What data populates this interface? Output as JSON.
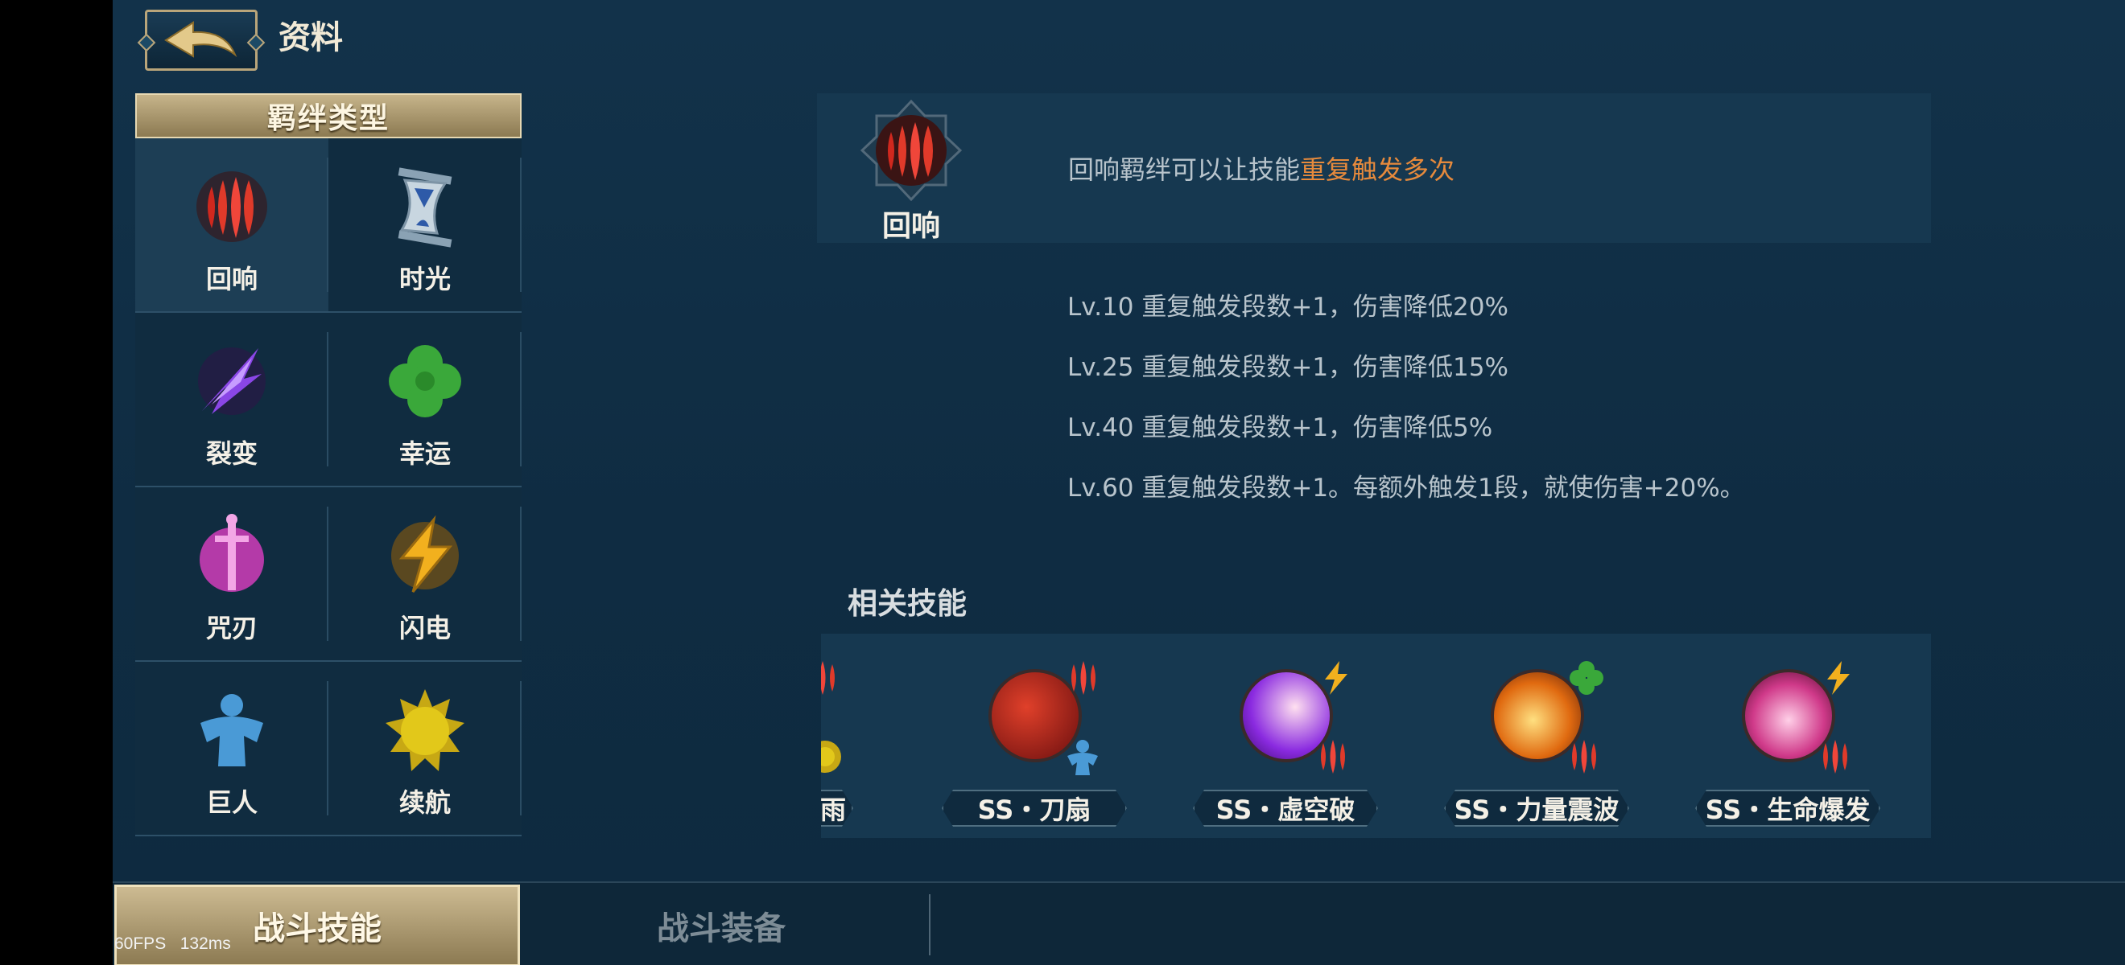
{
  "header": {
    "title": "资料"
  },
  "categories": {
    "title": "羁绊类型",
    "items": [
      {
        "label": "回响",
        "icon": "echo-icon"
      },
      {
        "label": "时光",
        "icon": "hourglass-icon"
      },
      {
        "label": "裂变",
        "icon": "fission-icon"
      },
      {
        "label": "幸运",
        "icon": "clover-icon"
      },
      {
        "label": "咒刃",
        "icon": "cursed-blade-icon"
      },
      {
        "label": "闪电",
        "icon": "lightning-icon"
      },
      {
        "label": "巨人",
        "icon": "giant-icon"
      },
      {
        "label": "续航",
        "icon": "sun-icon"
      }
    ]
  },
  "detail": {
    "name": "回响",
    "desc_prefix": "回响羁绊可以让技能",
    "desc_highlight": "重复触发多次",
    "levels": [
      "Lv.10  重复触发段数+1，伤害降低20%",
      "Lv.25  重复触发段数+1，伤害降低15%",
      "Lv.40  重复触发段数+1，伤害降低5%",
      "Lv.60  重复触发段数+1。每额外触发1段，就使伤害+20%。"
    ]
  },
  "related": {
    "title": "相关技能",
    "skills": [
      {
        "name": "雨"
      },
      {
        "name": "SS・刀扇"
      },
      {
        "name": "SS・虚空破"
      },
      {
        "name": "SS・力量震波"
      },
      {
        "name": "SS・生命爆发"
      }
    ]
  },
  "tabs": {
    "active": "战斗技能",
    "inactive": "战斗装备"
  },
  "debug": {
    "fps": "60FPS",
    "ms": "132ms"
  },
  "colors": {
    "highlight": "#e68a3c",
    "gold": "#c6b48a",
    "panel": "#163850"
  }
}
